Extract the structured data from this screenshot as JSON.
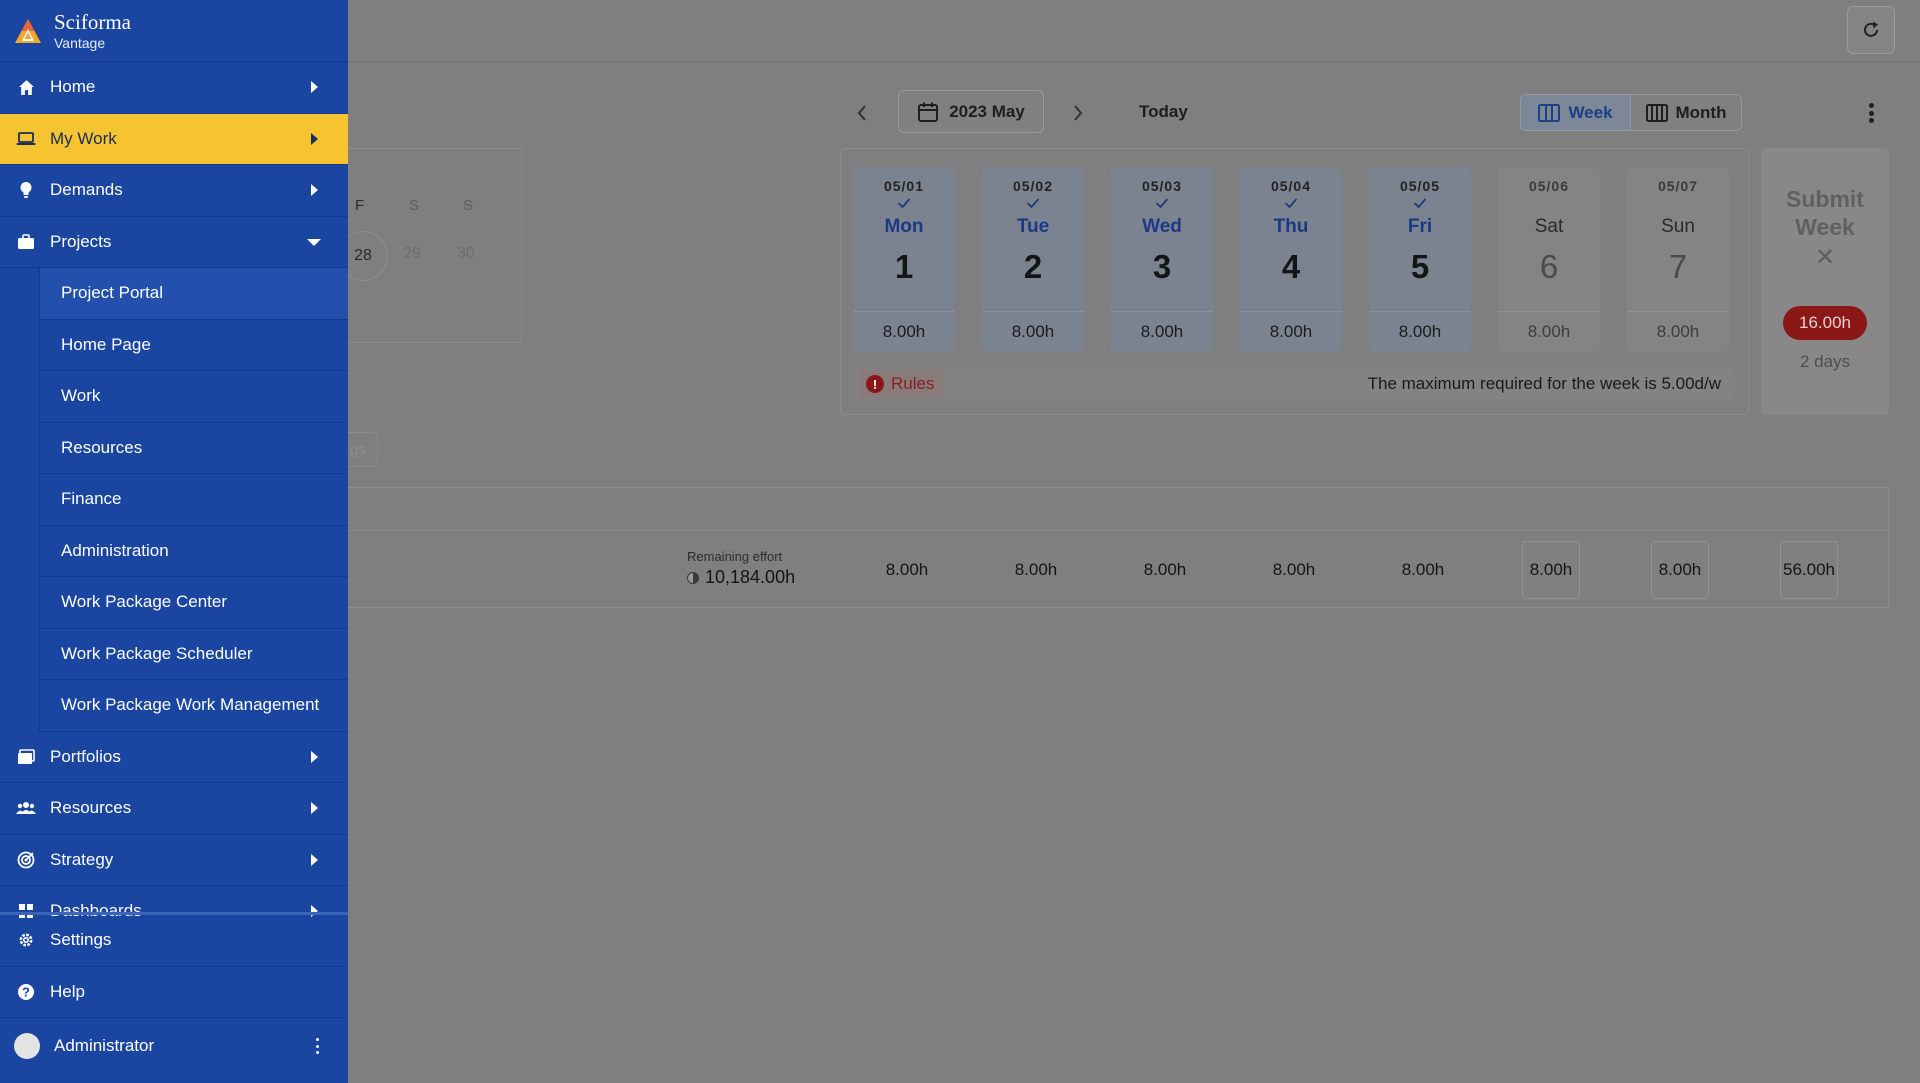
{
  "brand": {
    "name": "Sciforma",
    "subtitle": "Vantage"
  },
  "sidebar": {
    "items": [
      {
        "label": "Home"
      },
      {
        "label": "My Work"
      },
      {
        "label": "Demands"
      },
      {
        "label": "Projects"
      }
    ],
    "projects_subitems": [
      "Project Portal",
      "Home Page",
      "Work",
      "Resources",
      "Finance",
      "Administration",
      "Work Package Center",
      "Work Package Scheduler",
      "Work Package Work Management"
    ],
    "items_after": [
      {
        "label": "Portfolios"
      },
      {
        "label": "Resources"
      },
      {
        "label": "Strategy"
      },
      {
        "label": "Dashboards"
      }
    ],
    "bottom": [
      {
        "label": "Settings"
      },
      {
        "label": "Help"
      }
    ],
    "user": {
      "name": "Administrator"
    }
  },
  "toolbar": {
    "prev_icon": "chevron-left-icon",
    "next_icon": "chevron-right-icon",
    "period": "2023 May",
    "today": "Today",
    "week": "Week",
    "month": "Month",
    "active_view": "Week"
  },
  "mini_calendar": {
    "days_of_week": [
      "F",
      "S",
      "S"
    ],
    "dates": [
      "28",
      "29",
      "30"
    ],
    "selected": "28"
  },
  "partial_button_text": "gs",
  "week": {
    "days": [
      {
        "date": "05/01",
        "name": "Mon",
        "num": "1",
        "hours": "8.00h",
        "checked": true,
        "weekend": false
      },
      {
        "date": "05/02",
        "name": "Tue",
        "num": "2",
        "hours": "8.00h",
        "checked": true,
        "weekend": false
      },
      {
        "date": "05/03",
        "name": "Wed",
        "num": "3",
        "hours": "8.00h",
        "checked": true,
        "weekend": false
      },
      {
        "date": "05/04",
        "name": "Thu",
        "num": "4",
        "hours": "8.00h",
        "checked": true,
        "weekend": false
      },
      {
        "date": "05/05",
        "name": "Fri",
        "num": "5",
        "hours": "8.00h",
        "checked": true,
        "weekend": false
      },
      {
        "date": "05/06",
        "name": "Sat",
        "num": "6",
        "hours": "8.00h",
        "checked": false,
        "weekend": true
      },
      {
        "date": "05/07",
        "name": "Sun",
        "num": "7",
        "hours": "8.00h",
        "checked": false,
        "weekend": true
      }
    ],
    "rules_label": "Rules",
    "rules_message": "The maximum required for the week is 5.00d/w"
  },
  "submit": {
    "title_line1": "Submit",
    "title_line2": "Week",
    "hours": "16.00h",
    "days": "2 days"
  },
  "row": {
    "remaining_label": "Remaining effort",
    "remaining_value": "10,184.00h",
    "day_values": [
      "8.00h",
      "8.00h",
      "8.00h",
      "8.00h",
      "8.00h",
      "8.00h",
      "8.00h"
    ],
    "total": "56.00h"
  }
}
